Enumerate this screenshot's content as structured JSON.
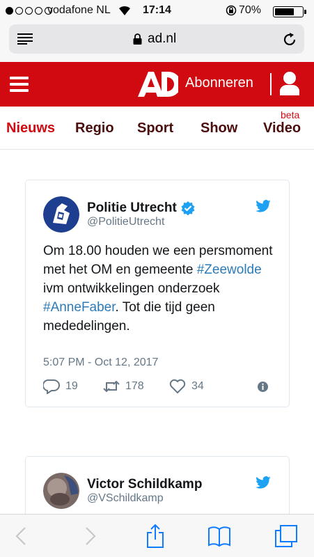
{
  "status_bar": {
    "carrier": "vodafone NL",
    "time": "17:14",
    "battery_percent": "70%",
    "battery_level": 0.7,
    "signal_bars": 1,
    "signal_total": 5
  },
  "browser": {
    "url": "ad.nl",
    "icons": [
      "reader-icon",
      "padlock-icon",
      "reload-icon"
    ]
  },
  "header": {
    "logo": "AD",
    "subscribe_label": "Abonneren",
    "brand_color": "#d10a11"
  },
  "nav": {
    "items": [
      "Nieuws",
      "Regio",
      "Sport",
      "Show",
      "Video"
    ],
    "active": "Nieuws",
    "beta_label": "beta"
  },
  "tweets": [
    {
      "name": "Politie Utrecht",
      "handle": "@PolitieUtrecht",
      "verified": true,
      "text_parts": [
        "Om 18.00 houden we een persmoment met het OM en gemeente ",
        "#Zeewolde",
        " ivm ontwikkelingen onderzoek ",
        "#AnneFaber",
        ". Tot die tijd geen mededelingen."
      ],
      "date": "5:07 PM - Oct 12, 2017",
      "replies": "19",
      "retweets": "178",
      "likes": "34"
    },
    {
      "name": "Victor Schildkamp",
      "handle": "@VSchildkamp",
      "verified": false
    }
  ],
  "colors": {
    "link": "#2b7bb9",
    "ios_blue": "#0f7bff",
    "muted": "#657786"
  }
}
